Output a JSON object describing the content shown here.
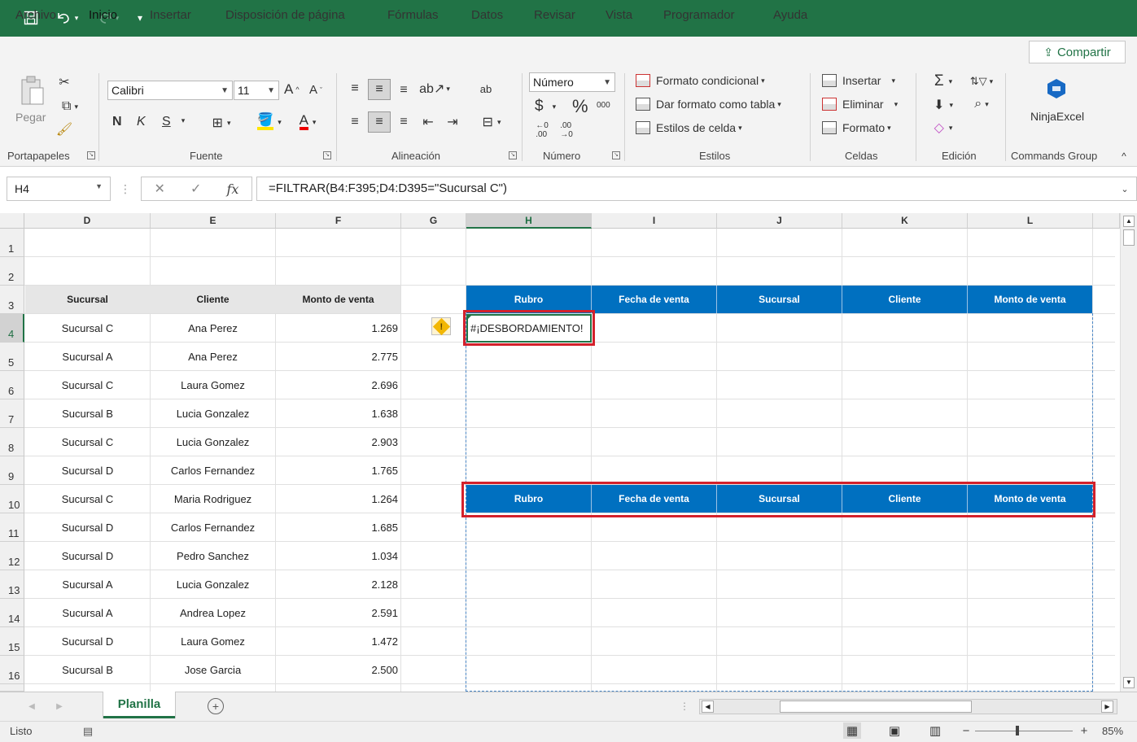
{
  "qat": {
    "save_icon": "save-icon",
    "undo_icon": "undo-icon",
    "redo_icon": "redo-icon",
    "customize_icon": "customize-icon"
  },
  "menu": {
    "tabs": [
      "Archivo",
      "Inicio",
      "Insertar",
      "Disposición de página",
      "Fórmulas",
      "Datos",
      "Revisar",
      "Vista",
      "Programador",
      "Ayuda"
    ],
    "active": "Inicio",
    "share_label": "Compartir"
  },
  "ribbon": {
    "clipboard": {
      "paste": "Pegar",
      "label": "Portapapeles"
    },
    "font": {
      "name": "Calibri",
      "size": "11",
      "bold": "N",
      "italic": "K",
      "underline": "S",
      "grow": "A",
      "shrink": "A",
      "label": "Fuente"
    },
    "alignment": {
      "label": "Alineación"
    },
    "number": {
      "format": "Número",
      "currency": "$",
      "percent": "%",
      "thousands": "000",
      "label": "Número"
    },
    "styles": {
      "conditional": "Formato condicional",
      "as_table": "Dar formato como tabla",
      "cell_styles": "Estilos de celda",
      "label": "Estilos"
    },
    "cells": {
      "insert": "Insertar",
      "delete": "Eliminar",
      "format": "Formato",
      "label": "Celdas"
    },
    "editing": {
      "label": "Edición"
    },
    "commands": {
      "addin": "NinjaExcel",
      "label": "Commands Group"
    }
  },
  "formula_bar": {
    "name_box": "H4",
    "fx": "fx",
    "formula": "=FILTRAR(B4:F395;D4:D395=\"Sucursal C\")"
  },
  "grid": {
    "columns": [
      "D",
      "E",
      "F",
      "G",
      "H",
      "I",
      "J",
      "K",
      "L"
    ],
    "rows": [
      "1",
      "2",
      "3",
      "4",
      "5",
      "6",
      "7",
      "8",
      "9",
      "10",
      "11",
      "12",
      "13",
      "14",
      "15",
      "16"
    ],
    "table_headers": [
      "Sucursal",
      "Cliente",
      "Monto de venta"
    ],
    "table_rows": [
      [
        "Sucursal C",
        "Ana Perez",
        "1.269"
      ],
      [
        "Sucursal A",
        "Ana Perez",
        "2.775"
      ],
      [
        "Sucursal C",
        "Laura Gomez",
        "2.696"
      ],
      [
        "Sucursal B",
        "Lucia Gonzalez",
        "1.638"
      ],
      [
        "Sucursal C",
        "Lucia Gonzalez",
        "2.903"
      ],
      [
        "Sucursal D",
        "Carlos Fernandez",
        "1.765"
      ],
      [
        "Sucursal C",
        "Maria Rodriguez",
        "1.264"
      ],
      [
        "Sucursal D",
        "Carlos Fernandez",
        "1.685"
      ],
      [
        "Sucursal D",
        "Pedro Sanchez",
        "1.034"
      ],
      [
        "Sucursal A",
        "Lucia Gonzalez",
        "2.128"
      ],
      [
        "Sucursal A",
        "Andrea Lopez",
        "2.591"
      ],
      [
        "Sucursal D",
        "Laura Gomez",
        "1.472"
      ],
      [
        "Sucursal B",
        "Jose Garcia",
        "2.500"
      ]
    ],
    "result_headers": [
      "Rubro",
      "Fecha de venta",
      "Sucursal",
      "Cliente",
      "Monto de venta"
    ],
    "result_headers_2": [
      "Rubro",
      "Fecha de venta",
      "Sucursal",
      "Cliente",
      "Monto de venta"
    ],
    "error_text": "#¡DESBORDAMIENTO!",
    "warning_icon": "warning-icon"
  },
  "sheets": {
    "active": "Planilla",
    "add_icon": "add-sheet-icon"
  },
  "status": {
    "mode": "Listo",
    "zoom": "85%"
  },
  "colors": {
    "excel_green": "#217346",
    "header_blue": "#0070c0",
    "highlight_red": "#d3212b"
  }
}
